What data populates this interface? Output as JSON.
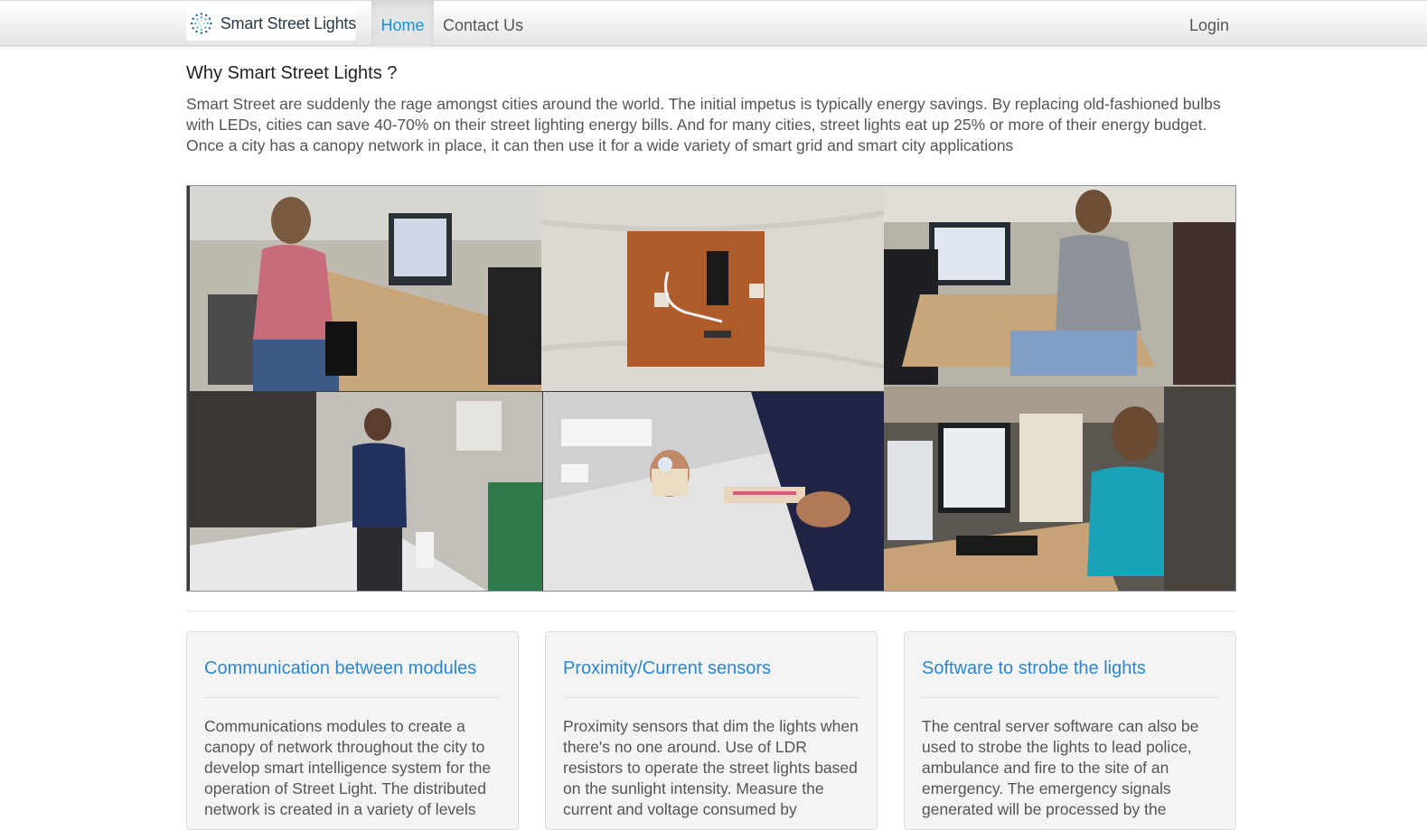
{
  "navbar": {
    "brand_name": "Smart Street Lights",
    "brand_icon": "dotted-circle-logo-icon",
    "items": [
      {
        "label": "Home",
        "active": true
      },
      {
        "label": "Contact Us",
        "active": false
      }
    ],
    "login_label": "Login"
  },
  "intro": {
    "title": "Why Smart Street Lights ?",
    "body": "Smart Street are suddenly the rage amongst cities around the world. The initial impetus is typically energy savings. By replacing old-fashioned bulbs with LEDs, cities can save 40-70% on their street lighting energy bills. And for many cities, street lights eat up 25% or more of their energy budget. Once a city has a canopy network in place, it can then use it for a wide variety of smart grid and smart city applications"
  },
  "gallery": {
    "photos": [
      "team-member-at-desktop-photo",
      "circuit-board-photo",
      "team-member-at-workstation-photo",
      "team-member-at-lab-bench-photo",
      "led-module-in-hand-photo",
      "team-member-at-dual-monitors-photo"
    ]
  },
  "features": [
    {
      "title": "Communication between modules",
      "text": "Communications modules to create a canopy of network throughout the city to develop smart intelligence system for the operation of Street Light. The distributed network is created in a variety of levels"
    },
    {
      "title": "Proximity/Current sensors",
      "text": "Proximity sensors that dim the lights when there's no one around. Use of LDR resistors to operate the street lights based on the sunlight intensity. Measure the current and voltage consumed by"
    },
    {
      "title": "Software to strobe the lights",
      "text": "The central server software can also be used to strobe the lights to lead police, ambulance and fire to the site of an emergency. The emergency signals generated will be processed by the"
    }
  ],
  "colors": {
    "accent": "#1a93cf",
    "card_title": "#2a86cf",
    "card_bg": "#f4f4f4"
  }
}
